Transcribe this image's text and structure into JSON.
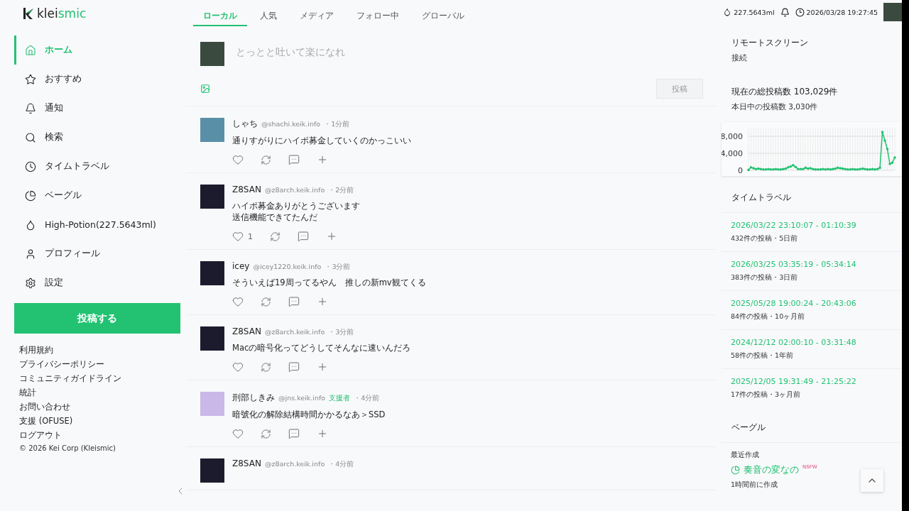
{
  "logo": {
    "text_main": "klei",
    "text_accent": "smic"
  },
  "nav": [
    {
      "label": "ホーム",
      "selected": true
    },
    {
      "label": "おすすめ",
      "selected": false
    },
    {
      "label": "通知",
      "selected": false
    },
    {
      "label": "検索",
      "selected": false
    },
    {
      "label": "タイムトラベル",
      "selected": false
    },
    {
      "label": "ベーグル",
      "selected": false
    },
    {
      "label": "High-Potion(227.5643ml)",
      "selected": false
    },
    {
      "label": "プロフィール",
      "selected": false
    },
    {
      "label": "設定",
      "selected": false
    }
  ],
  "post_button": "投稿する",
  "footer_links": [
    "利用規約",
    "プライバシーポリシー",
    "コミュニティガイドライン",
    "統計",
    "お問い合わせ",
    "支援 (OFUSE)",
    "ログアウト"
  ],
  "copyright": "© 2026 Kei Corp (Kleismic)",
  "tabs": [
    {
      "label": "ローカル",
      "selected": true
    },
    {
      "label": "人気",
      "selected": false
    },
    {
      "label": "メディア",
      "selected": false
    },
    {
      "label": "フォロー中",
      "selected": false
    },
    {
      "label": "グローバル",
      "selected": false
    }
  ],
  "composer": {
    "placeholder": "とっとと吐いて楽になれ",
    "submit": "投稿"
  },
  "posts": [
    {
      "name": "しゃち",
      "handle": "@shachi.keik.info",
      "time": "・1分前",
      "text": [
        "通りすがりにハイポ募金していくのかっこいい"
      ]
    },
    {
      "name": "Z8SAN",
      "handle": "@z8arch.keik.info",
      "time": "・2分前",
      "text": [
        "ハイポ募金ありがとうございます",
        "送信機能できてたんだ"
      ],
      "likes": "1"
    },
    {
      "name": "icey",
      "handle": "@icey1220.keik.info",
      "time": "・3分前",
      "text": [
        "そういえば19周ってるやん　推しの新mv観てくる"
      ]
    },
    {
      "name": "Z8SAN",
      "handle": "@z8arch.keik.info",
      "time": "・3分前",
      "text": [
        "Macの暗号化ってどうしてそんなに速いんだろ"
      ]
    },
    {
      "name": "刑部しきみ",
      "handle": "@jns.keik.info",
      "badge": "支援者",
      "time": "・4分前",
      "text": [
        "暗號化の解除結構時間かかるなあ＞SSD"
      ]
    },
    {
      "name": "Z8SAN",
      "handle": "@z8arch.keik.info",
      "time": "・4分前"
    }
  ],
  "topbar": {
    "potion": "227.5643ml",
    "datetime": "2026/03/28 19:27:45"
  },
  "remote": {
    "title": "リモートスクリーン",
    "status": "接続"
  },
  "stats": {
    "title": "現在の総投稿数 103,029件",
    "subtitle": "本日中の投稿数 3,030件",
    "chart_data": {
      "type": "line",
      "grid": true,
      "ylim": [
        0,
        10000
      ],
      "yticks": [
        {
          "value": 0,
          "label": "0"
        },
        {
          "value": 4000,
          "label": "4,000"
        },
        {
          "value": 8000,
          "label": "8,000"
        }
      ],
      "series": [
        {
          "color": "#22c272",
          "values": [
            100,
            700,
            500,
            300,
            400,
            300,
            200,
            200,
            300,
            200,
            200,
            300,
            200,
            200,
            300,
            400,
            700,
            900,
            1200,
            800,
            300,
            300,
            300,
            600,
            400,
            500,
            300,
            200,
            200,
            200,
            300,
            200,
            300,
            200,
            300,
            400,
            600,
            500,
            400,
            300,
            200,
            200,
            300,
            200,
            200,
            300,
            400,
            300,
            200,
            200,
            300,
            200,
            300,
            600,
            9000,
            7000,
            5000,
            1500,
            1800,
            3000
          ]
        }
      ]
    }
  },
  "timetravel": {
    "title": "タイムトラベル",
    "items": [
      {
        "range": "2026/03/22 23:10:07 - 01:10:39",
        "meta": "432件の投稿・5日前"
      },
      {
        "range": "2026/03/25 03:35:19 - 05:34:14",
        "meta": "383件の投稿・3日前"
      },
      {
        "range": "2025/05/28 19:00:24 - 20:43:06",
        "meta": "84件の投稿・10ヶ月前"
      },
      {
        "range": "2024/12/12 02:00:10 - 03:31:48",
        "meta": "58件の投稿・1年前"
      },
      {
        "range": "2025/12/05 19:31:49 - 21:25:22",
        "meta": "17件の投稿・3ヶ月前"
      }
    ]
  },
  "bagel": {
    "title": "ベーグル",
    "label": "最近作成",
    "name": "奏音の変なの",
    "tag": "NSFW",
    "meta": "1時間前に作成"
  }
}
